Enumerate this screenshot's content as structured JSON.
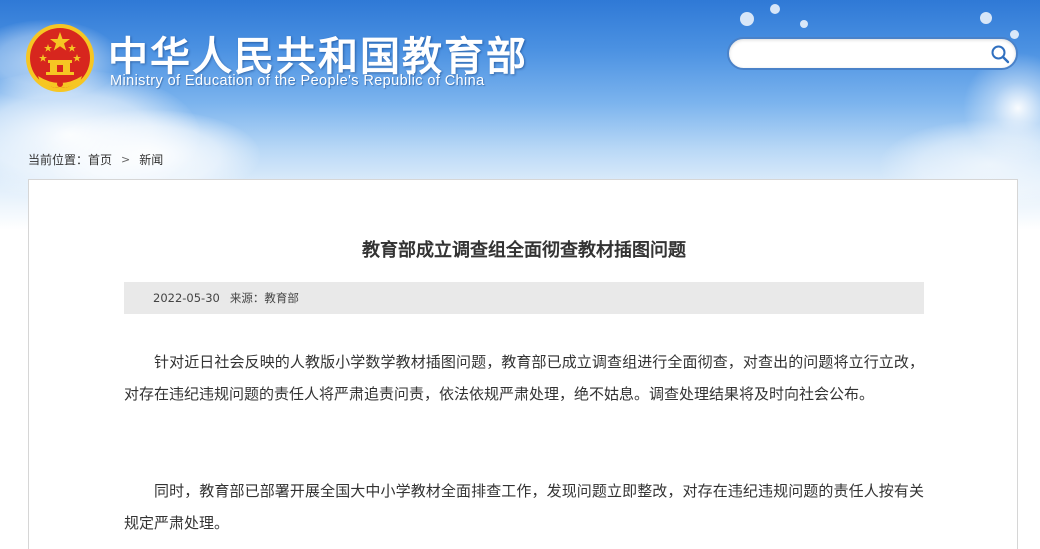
{
  "site": {
    "title_cn": "中华人民共和国教育部",
    "title_en": "Ministry of Education of the People's Republic of China"
  },
  "search": {
    "placeholder": "",
    "value": ""
  },
  "breadcrumb": {
    "label": "当前位置：",
    "home": "首页",
    "separator": ">",
    "current": "新闻"
  },
  "article": {
    "title": "教育部成立调查组全面彻查教材插图问题",
    "date": "2022-05-30",
    "source": "来源：教育部",
    "paragraphs": [
      "针对近日社会反映的人教版小学数学教材插图问题，教育部已成立调查组进行全面彻查，对查出的问题将立行立改，对存在违纪违规问题的责任人将严肃追责问责，依法依规严肃处理，绝不姑息。调查处理结果将及时向社会公布。",
      "同时，教育部已部署开展全国大中小学教材全面排查工作，发现问题立即整改，对存在违纪违规问题的责任人按有关规定严肃处理。"
    ]
  },
  "colors": {
    "header_top": "#2f79d6",
    "emblem_red": "#d7261e",
    "emblem_gold": "#f6c623",
    "search_border": "#4a82c9",
    "meta_bg": "#e9e9e9",
    "text": "#333333"
  },
  "icons": {
    "emblem": "national-emblem-icon",
    "search": "search-icon",
    "breadcrumb_separator": "chevron-right-icon"
  }
}
